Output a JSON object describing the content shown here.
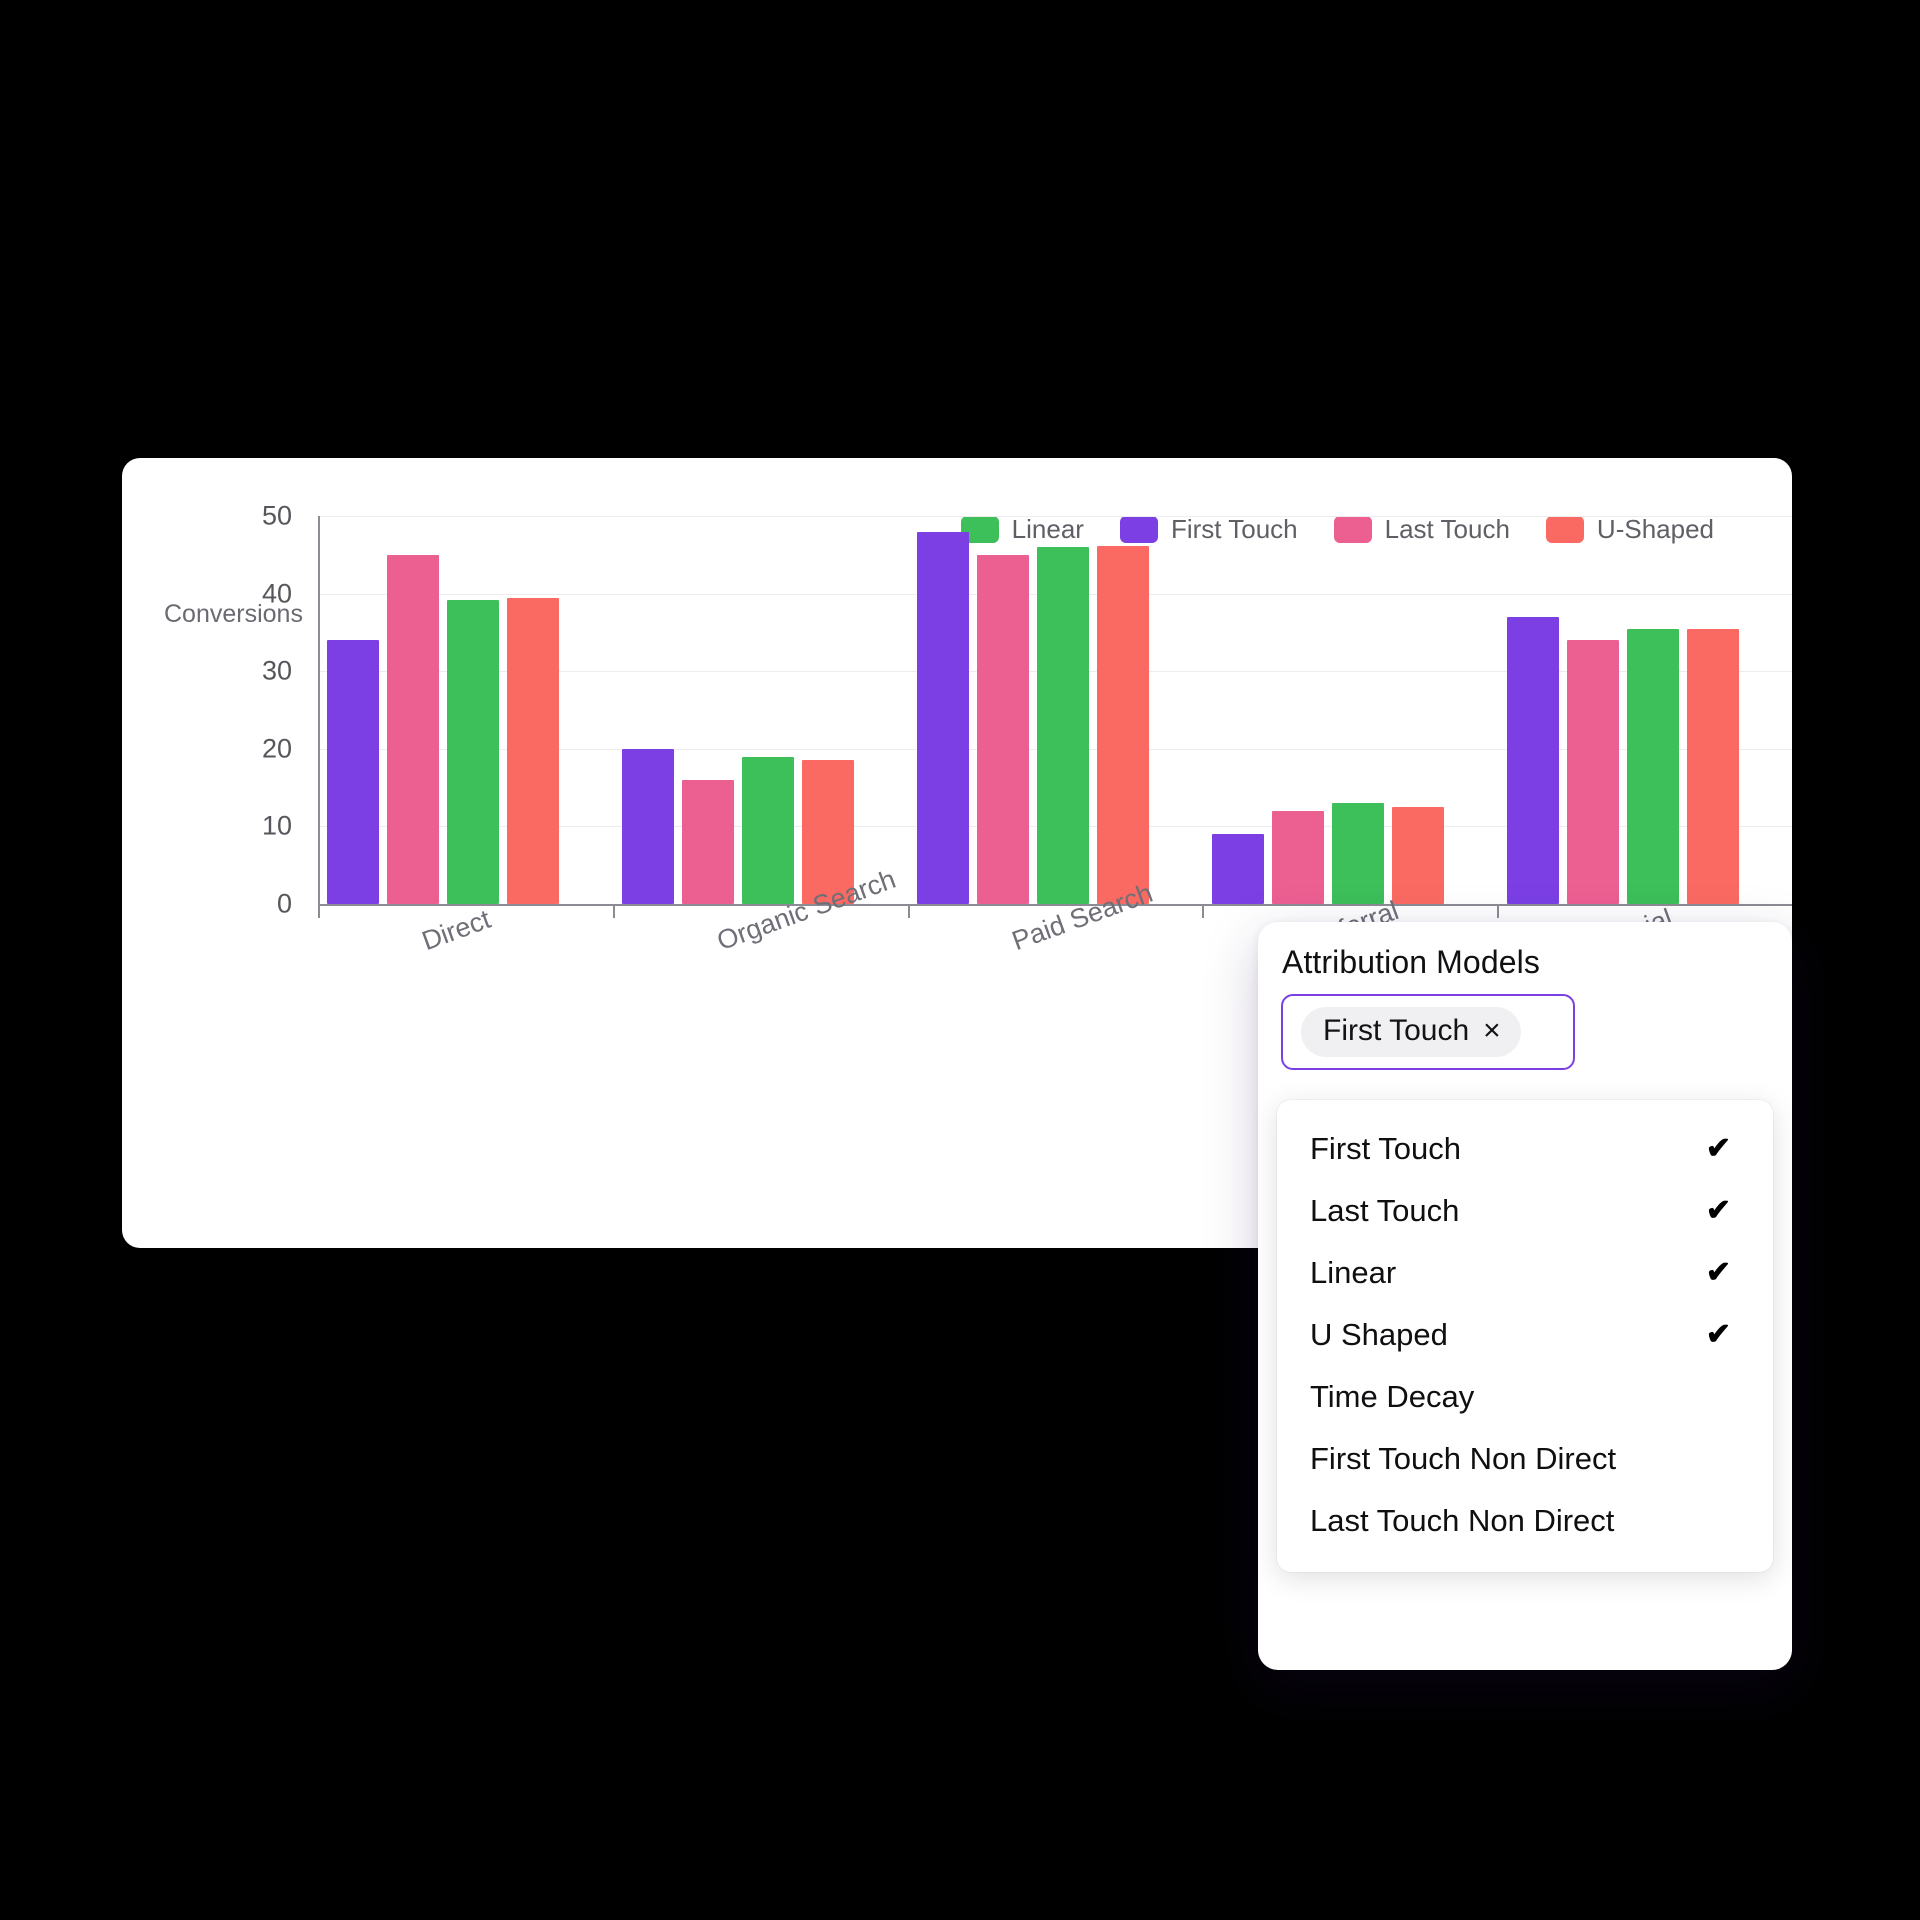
{
  "chart_card": {
    "y_axis_title": "Conversions"
  },
  "legend": {
    "items": [
      {
        "label": "Linear",
        "color": "#3DBF5A"
      },
      {
        "label": "First Touch",
        "color": "#7B3FE4"
      },
      {
        "label": "Last Touch",
        "color": "#EC5F91"
      },
      {
        "label": "U-Shaped",
        "color": "#FA6A62"
      }
    ]
  },
  "attribution_panel": {
    "title": "Attribution Models",
    "selected_chip": {
      "label": "First Touch",
      "remove_icon": "×"
    },
    "check_icon": "✔",
    "options": [
      {
        "label": "First Touch",
        "checked": true
      },
      {
        "label": "Last Touch",
        "checked": true
      },
      {
        "label": "Linear",
        "checked": true
      },
      {
        "label": "U Shaped",
        "checked": true
      },
      {
        "label": "Time Decay",
        "checked": false
      },
      {
        "label": "First Touch Non Direct",
        "checked": false
      },
      {
        "label": "Last Touch Non Direct",
        "checked": false
      }
    ]
  },
  "chart_data": {
    "type": "bar",
    "title": "",
    "xlabel": "",
    "ylabel": "Conversions",
    "ylim": [
      0,
      50
    ],
    "yticks": [
      0,
      10,
      20,
      30,
      40,
      50
    ],
    "grid": true,
    "legend_position": "top-right",
    "categories": [
      "Direct",
      "Organic Search",
      "Paid Search",
      "Referral",
      "Social"
    ],
    "series": [
      {
        "name": "First Touch",
        "color": "#7B3FE4",
        "values": [
          34.0,
          20.0,
          48.0,
          9.0,
          37.0
        ]
      },
      {
        "name": "Last Touch",
        "color": "#EC5F91",
        "values": [
          45.0,
          16.0,
          45.0,
          12.0,
          34.0
        ]
      },
      {
        "name": "Linear",
        "color": "#3DBF5A",
        "values": [
          39.2,
          19.0,
          46.0,
          13.0,
          35.5
        ]
      },
      {
        "name": "U-Shaped",
        "color": "#FA6A62",
        "values": [
          39.4,
          18.5,
          46.1,
          12.5,
          35.4
        ]
      }
    ],
    "series_draw_order": [
      "First Touch",
      "Last Touch",
      "Linear",
      "U-Shaped"
    ]
  }
}
